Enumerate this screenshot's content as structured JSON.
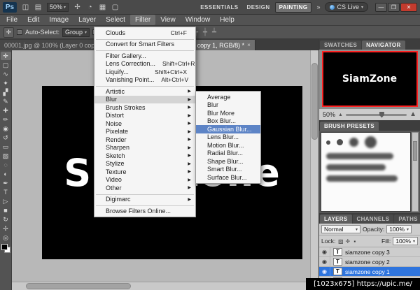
{
  "app_bar": {
    "logo": "Ps",
    "left_icons": [
      {
        "glyph": "◫",
        "name": "launch-bridge-icon"
      },
      {
        "glyph": "▤",
        "name": "view-extras-icon"
      }
    ],
    "zoom_value": "50%",
    "mid_icons": [
      {
        "glyph": "✢",
        "name": "hand-tool-icon"
      },
      {
        "glyph": "◔",
        "name": "rotate-view-icon"
      },
      {
        "glyph": "▦",
        "name": "arrange-documents-icon"
      },
      {
        "glyph": "▢",
        "name": "screen-mode-icon"
      }
    ],
    "workspaces": [
      {
        "label": "ESSENTIALS"
      },
      {
        "label": "DESIGN"
      },
      {
        "label": "PAINTING",
        "active": true
      }
    ],
    "overflow": "»",
    "cs_live": "CS Live",
    "window_buttons": {
      "minimize": "—",
      "maximize": "❐",
      "close": "✕"
    }
  },
  "menu_bar": {
    "items": [
      {
        "label": "File"
      },
      {
        "label": "Edit"
      },
      {
        "label": "Image"
      },
      {
        "label": "Layer"
      },
      {
        "label": "Select"
      },
      {
        "label": "Filter",
        "active": true
      },
      {
        "label": "View"
      },
      {
        "label": "Window"
      },
      {
        "label": "Help"
      }
    ]
  },
  "options_bar": {
    "tool_icon": "✛",
    "auto_select_label": "Auto-Select:",
    "auto_select_value": "Group",
    "align_icons": [
      {
        "glyph": "╟",
        "name": "align-left-icon"
      },
      {
        "glyph": "╫",
        "name": "align-h-center-icon"
      },
      {
        "glyph": "╢",
        "name": "align-right-icon"
      },
      {
        "glyph": "╤",
        "name": "align-top-icon"
      },
      {
        "glyph": "╪",
        "name": "align-v-center-icon"
      },
      {
        "glyph": "╧",
        "name": "align-bottom-icon"
      }
    ],
    "distribute_icons": [
      {
        "glyph": "┠",
        "name": "distribute-left-icon"
      },
      {
        "glyph": "╂",
        "name": "distribute-h-center-icon"
      },
      {
        "glyph": "┨",
        "name": "distribute-right-icon"
      },
      {
        "glyph": "┯",
        "name": "distribute-top-icon"
      },
      {
        "glyph": "┿",
        "name": "distribute-v-center-icon"
      },
      {
        "glyph": "┷",
        "name": "distribute-bottom-icon"
      }
    ]
  },
  "document_tabs": [
    {
      "label": "00001.jpg @ 100% (Layer 0 cop..."
    },
    {
      "label": "Untitled-1 @ 50% (siamzone copy 1, RGB/8) *",
      "active": true
    }
  ],
  "toolbar": {
    "tools": [
      {
        "glyph": "✛",
        "name": "move-tool",
        "active": true
      },
      {
        "glyph": "▢",
        "name": "marquee-tool"
      },
      {
        "glyph": "∿",
        "name": "lasso-tool"
      },
      {
        "glyph": "✦",
        "name": "quick-selection-tool"
      },
      {
        "glyph": "▞",
        "name": "crop-tool"
      },
      {
        "glyph": "✎",
        "name": "eyedropper-tool"
      },
      {
        "glyph": "✚",
        "name": "healing-brush-tool"
      },
      {
        "glyph": "✏",
        "name": "brush-tool"
      },
      {
        "glyph": "◉",
        "name": "clone-stamp-tool"
      },
      {
        "glyph": "↺",
        "name": "history-brush-tool"
      },
      {
        "glyph": "▭",
        "name": "eraser-tool"
      },
      {
        "glyph": "▧",
        "name": "gradient-tool"
      },
      {
        "glyph": "◌",
        "name": "blur-tool"
      },
      {
        "glyph": "◐",
        "name": "dodge-tool"
      },
      {
        "glyph": "✒",
        "name": "pen-tool"
      },
      {
        "glyph": "T",
        "name": "type-tool"
      },
      {
        "glyph": "▷",
        "name": "path-selection-tool"
      },
      {
        "glyph": "■",
        "name": "shape-tool"
      },
      {
        "glyph": "↻",
        "name": "rotate-3d-tool"
      },
      {
        "glyph": "✢",
        "name": "hand-tool"
      },
      {
        "glyph": "◎",
        "name": "zoom-tool"
      }
    ]
  },
  "canvas": {
    "text": "SiamZone"
  },
  "filter_menu": {
    "items": [
      {
        "label": "Clouds",
        "shortcut": "Ctrl+F"
      },
      {
        "separator": true
      },
      {
        "label": "Convert for Smart Filters"
      },
      {
        "separator": true
      },
      {
        "label": "Filter Gallery..."
      },
      {
        "label": "Lens Correction...",
        "shortcut": "Shift+Ctrl+R"
      },
      {
        "label": "Liquify...",
        "shortcut": "Shift+Ctrl+X"
      },
      {
        "label": "Vanishing Point...",
        "shortcut": "Alt+Ctrl+V"
      },
      {
        "separator": true
      },
      {
        "label": "Artistic",
        "arrow": "▶"
      },
      {
        "label": "Blur",
        "arrow": "▶",
        "active": true
      },
      {
        "label": "Brush Strokes",
        "arrow": "▶"
      },
      {
        "label": "Distort",
        "arrow": "▶"
      },
      {
        "label": "Noise",
        "arrow": "▶"
      },
      {
        "label": "Pixelate",
        "arrow": "▶"
      },
      {
        "label": "Render",
        "arrow": "▶"
      },
      {
        "label": "Sharpen",
        "arrow": "▶"
      },
      {
        "label": "Sketch",
        "arrow": "▶"
      },
      {
        "label": "Stylize",
        "arrow": "▶"
      },
      {
        "label": "Texture",
        "arrow": "▶"
      },
      {
        "label": "Video",
        "arrow": "▶"
      },
      {
        "label": "Other",
        "arrow": "▶"
      },
      {
        "separator": true
      },
      {
        "label": "Digimarc",
        "arrow": "▶"
      },
      {
        "separator": true
      },
      {
        "label": "Browse Filters Online..."
      }
    ]
  },
  "blur_submenu": {
    "items": [
      {
        "label": "Average"
      },
      {
        "label": "Blur"
      },
      {
        "label": "Blur More"
      },
      {
        "label": "Box Blur..."
      },
      {
        "label": "Gaussian Blur...",
        "active": true
      },
      {
        "label": "Lens Blur..."
      },
      {
        "label": "Motion Blur..."
      },
      {
        "label": "Radial Blur..."
      },
      {
        "label": "Shape Blur..."
      },
      {
        "label": "Smart Blur..."
      },
      {
        "label": "Surface Blur..."
      }
    ]
  },
  "panels": {
    "top_tabs": [
      {
        "label": "SWATCHES"
      },
      {
        "label": "NAVIGATOR",
        "active": true
      }
    ],
    "navigator": {
      "preview_text": "SiamZone",
      "zoom": "50%"
    },
    "brush_presets": {
      "tab": "BRUSH PRESETS"
    },
    "layers_tabs": [
      {
        "label": "LAYERS",
        "active": true
      },
      {
        "label": "CHANNELS"
      },
      {
        "label": "PATHS"
      }
    ],
    "layers": {
      "blend_mode": "Normal",
      "opacity_label": "Opacity:",
      "opacity": "100%",
      "lock_label": "Lock:",
      "fill_label": "Fill:",
      "fill": "100%",
      "lock_icons": [
        {
          "glyph": "▨",
          "name": "lock-transparency-icon"
        },
        {
          "glyph": "✛",
          "name": "lock-position-icon"
        },
        {
          "glyph": "▪",
          "name": "lock-all-icon"
        }
      ],
      "rows": [
        {
          "label": "siamzone copy 3"
        },
        {
          "label": "siamzone copy 2"
        },
        {
          "label": "siamzone copy 1",
          "active": true
        },
        {
          "label": ""
        }
      ]
    }
  },
  "watermark": "[1023x675] https://upic.me/",
  "icons": {
    "tab_close": "×",
    "dropdown_arrow": "▾",
    "eye": "◉",
    "type_thumb": "T",
    "zoom_out": "▲",
    "zoom_in": "▲"
  }
}
